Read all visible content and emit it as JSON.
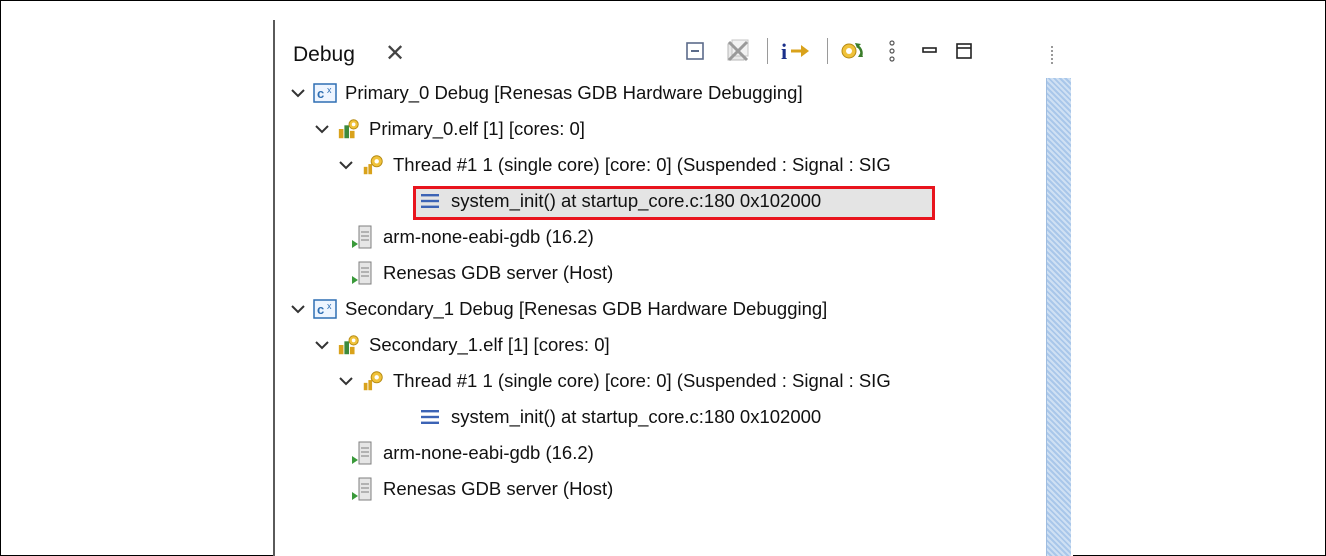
{
  "panel": {
    "tab_title": "Debug",
    "tab_close_glyph": "✕"
  },
  "toolbar": {
    "icons": [
      "collapse-all-icon",
      "remove-terminated-icon",
      "instruction-stepping-icon",
      "relaunch-icon",
      "view-menu-icon",
      "minimize-icon",
      "maximize-icon"
    ]
  },
  "tree": {
    "items": [
      {
        "label": "Primary_0 Debug [Renesas GDB Hardware Debugging]",
        "kind": "launch"
      },
      {
        "label": "Primary_0.elf [1] [cores: 0]",
        "kind": "process"
      },
      {
        "label": "Thread #1 1 (single core) [core: 0] (Suspended : Signal : SIG",
        "kind": "thread"
      },
      {
        "label": "system_init() at startup_core.c:180 0x102000",
        "kind": "frame",
        "selected": true
      },
      {
        "label": "arm-none-eabi-gdb (16.2)",
        "kind": "gdb"
      },
      {
        "label": "Renesas GDB server (Host)",
        "kind": "server"
      },
      {
        "label": "Secondary_1 Debug [Renesas GDB Hardware Debugging]",
        "kind": "launch"
      },
      {
        "label": "Secondary_1.elf [1] [cores: 0]",
        "kind": "process"
      },
      {
        "label": "Thread #1 1 (single core) [core: 0] (Suspended : Signal : SIG",
        "kind": "thread"
      },
      {
        "label": "system_init() at startup_core.c:180 0x102000",
        "kind": "frame",
        "selected": false
      },
      {
        "label": "arm-none-eabi-gdb (16.2)",
        "kind": "gdb"
      },
      {
        "label": "Renesas GDB server (Host)",
        "kind": "server"
      }
    ]
  },
  "colors": {
    "highlight_border": "#e8141d",
    "selection_bg": "#e4e4e4",
    "launch_icon": "#2f6fb3",
    "thread_icon": "#d9a21b",
    "frame_icon": "#3c63b5",
    "gdb_icon": "#7f7f7f"
  }
}
